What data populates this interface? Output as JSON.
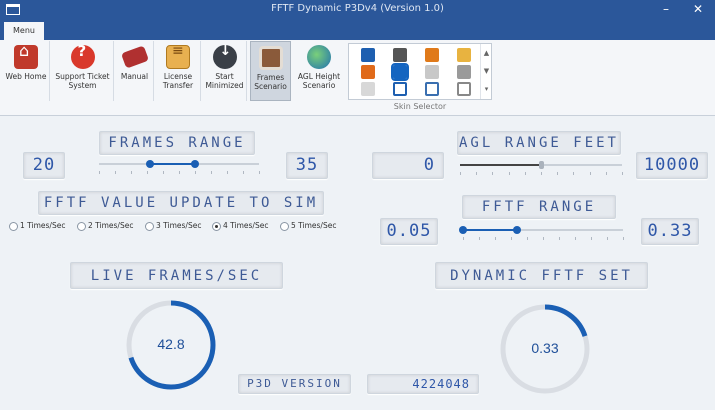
{
  "window": {
    "title": "FFTF Dynamic P3Dv4 (Version 1.0)",
    "minimize_glyph": "–",
    "close_glyph": "✕"
  },
  "menu_tab": "Menu",
  "ribbon": {
    "buttons": [
      {
        "label": "Web Home",
        "icon": "home-icon"
      },
      {
        "label": "Support Ticket System",
        "icon": "support-icon"
      },
      {
        "label": "Manual",
        "icon": "manual-icon"
      },
      {
        "label": "License Transfer",
        "icon": "license-icon"
      },
      {
        "label": "Start Minimized",
        "icon": "download-arrow-icon"
      },
      {
        "label": "Frames Scenario",
        "icon": "frames-icon",
        "active": true
      },
      {
        "label": "AGL Height Scenario",
        "icon": "globe-icon"
      }
    ],
    "skin_selector": {
      "label": "Skin Selector",
      "skins": [
        "office-2013-blue",
        "office-2010-black",
        "office-orange",
        "office-yellow",
        "office-orange-2",
        "office-2016-blue",
        "office-gray",
        "office-gray-2",
        "office-white",
        "office-blue-outline",
        "office-blue-outline-2",
        "office-gray-outline"
      ],
      "selected_index": 5,
      "scroll_up": "▲",
      "scroll_down": "▼",
      "expand": "▾"
    }
  },
  "frames": {
    "section_label": "FRAMES RANGE",
    "min_value": "20",
    "max_value": "35",
    "slider_low": 0.32,
    "slider_high": 0.6
  },
  "agl": {
    "section_label": "AGL RANGE FEET",
    "min_value": "0",
    "max_value": "10000",
    "slider_level": 0.5
  },
  "update_rate": {
    "section_label": "FFTF VALUE UPDATE TO SIM",
    "options": [
      "1 Times/Sec",
      "2 Times/Sec",
      "3 Times/Sec",
      "4 Times/Sec",
      "5 Times/Sec"
    ],
    "selected": "4 Times/Sec"
  },
  "fftf": {
    "section_label": "FFTF RANGE",
    "min_value": "0.05",
    "max_value": "0.33",
    "slider_low": 0.0,
    "slider_high": 0.34
  },
  "live_frames": {
    "section_label": "LIVE FRAMES/SEC",
    "value": "42.8",
    "level": 0.7
  },
  "dynamic_fftf": {
    "section_label": "DYNAMIC FFTF SET",
    "value": "0.33",
    "level": 0.2
  },
  "p3d": {
    "label": "P3D VERSION",
    "value": "4224048"
  },
  "colors": {
    "accent": "#1a5fb4",
    "titlebar": "#2b579a",
    "gauge_track": "#d9dde3"
  }
}
